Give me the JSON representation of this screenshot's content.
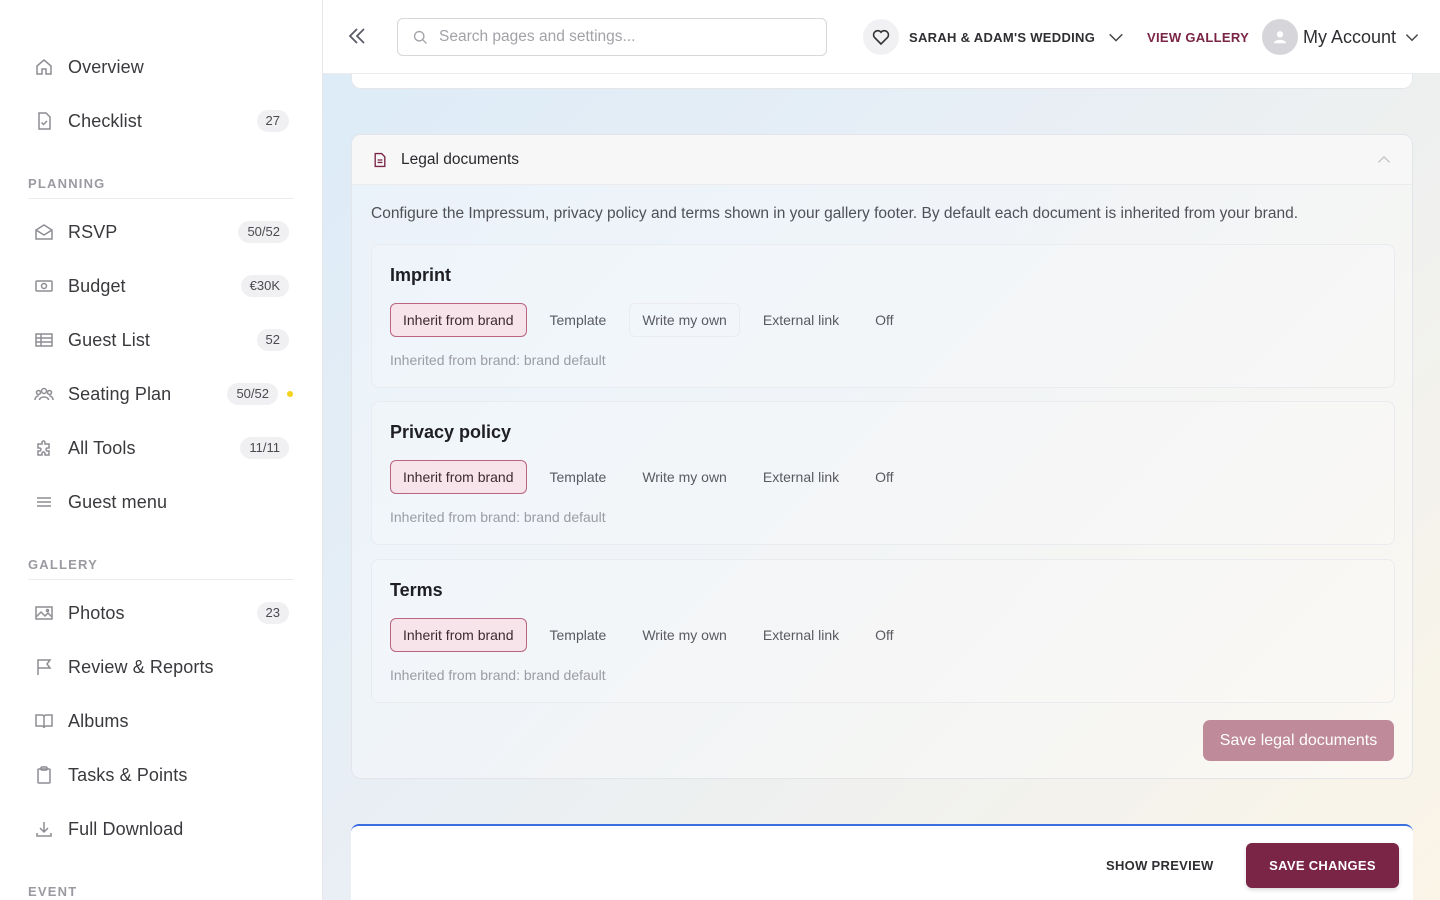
{
  "sidebar": {
    "top_items": [
      {
        "label": "Overview",
        "icon": "home-icon",
        "badge": ""
      },
      {
        "label": "Checklist",
        "icon": "checklist-icon",
        "badge": "27"
      }
    ],
    "planning_label": "PLANNING",
    "planning_items": [
      {
        "label": "RSVP",
        "icon": "envelope-icon",
        "badge": "50/52"
      },
      {
        "label": "Budget",
        "icon": "money-icon",
        "badge": "€30K"
      },
      {
        "label": "Guest List",
        "icon": "table-icon",
        "badge": "52"
      },
      {
        "label": "Seating Plan",
        "icon": "people-icon",
        "badge": "50/52",
        "dot_color": "#f5d21b"
      },
      {
        "label": "All Tools",
        "icon": "puzzle-icon",
        "badge": "11/11"
      },
      {
        "label": "Guest menu",
        "icon": "menu-icon",
        "badge": ""
      }
    ],
    "gallery_label": "GALLERY",
    "gallery_items": [
      {
        "label": "Photos",
        "icon": "image-icon",
        "badge": "23"
      },
      {
        "label": "Review & Reports",
        "icon": "flag-icon",
        "badge": ""
      },
      {
        "label": "Albums",
        "icon": "book-icon",
        "badge": ""
      },
      {
        "label": "Tasks & Points",
        "icon": "clipboard-icon",
        "badge": ""
      },
      {
        "label": "Full Download",
        "icon": "download-icon",
        "badge": ""
      }
    ],
    "event_label": "EVENT"
  },
  "topbar": {
    "search_placeholder": "Search pages and settings...",
    "event_name": "SARAH & ADAM'S WEDDING",
    "view_gallery": "VIEW GALLERY",
    "account_label": "My Account"
  },
  "legal": {
    "title": "Legal documents",
    "description": "Configure the Impressum, privacy policy and terms shown in your gallery footer. By default each document is inherited from your brand.",
    "documents": [
      {
        "title": "Imprint",
        "options": [
          "Inherit from brand",
          "Template",
          "Write my own",
          "External link",
          "Off"
        ],
        "selected": "Inherit from brand",
        "note": "Inherited from brand: brand default"
      },
      {
        "title": "Privacy policy",
        "options": [
          "Inherit from brand",
          "Template",
          "Write my own",
          "External link",
          "Off"
        ],
        "selected": "Inherit from brand",
        "note": "Inherited from brand: brand default"
      },
      {
        "title": "Terms",
        "options": [
          "Inherit from brand",
          "Template",
          "Write my own",
          "External link",
          "Off"
        ],
        "selected": "Inherit from brand",
        "note": "Inherited from brand: brand default"
      }
    ],
    "save_label": "Save legal documents"
  },
  "footer": {
    "show_preview": "SHOW PREVIEW",
    "save_changes": "SAVE CHANGES"
  },
  "colors": {
    "brand": "#7a2446",
    "accent_blue": "#3b6fe0",
    "save_legal_bg": "#bf8a9a"
  }
}
